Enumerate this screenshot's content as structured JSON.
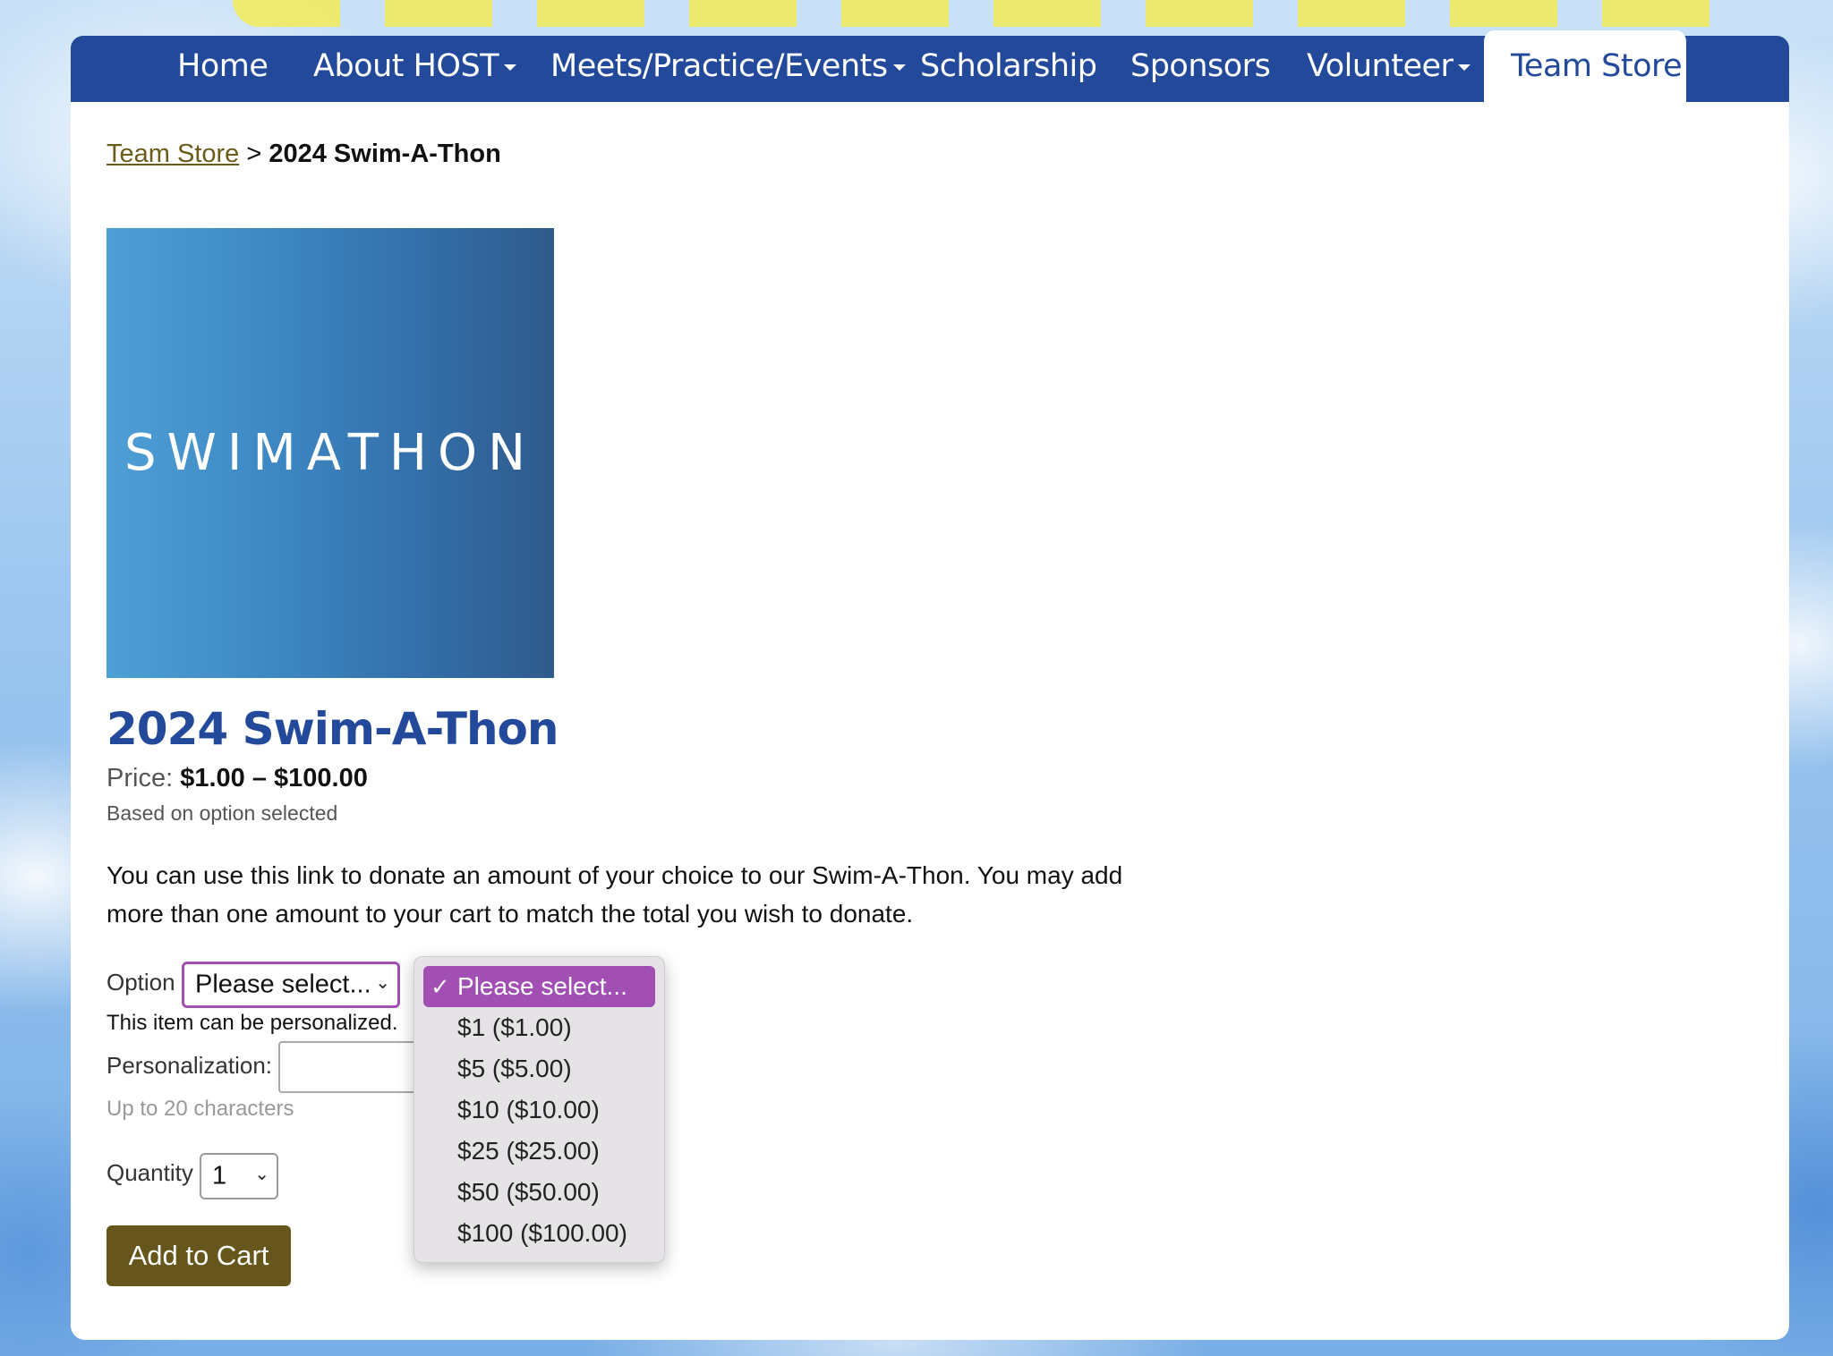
{
  "colors": {
    "nav_background": "#23499a",
    "title": "#23499a",
    "add_to_cart_bg": "#66561b",
    "selected_option": "#a24fb3"
  },
  "nav": {
    "items": [
      {
        "label": "Home",
        "has_caret": false
      },
      {
        "label": "About HOST",
        "has_caret": true
      },
      {
        "label": "Meets/Practice/Events",
        "has_caret": true
      },
      {
        "label": "Scholarship",
        "has_caret": false
      },
      {
        "label": "Sponsors",
        "has_caret": false
      },
      {
        "label": "Volunteer",
        "has_caret": true
      },
      {
        "label": "Team Store",
        "has_caret": false,
        "active": true
      }
    ]
  },
  "breadcrumb": {
    "parent": "Team Store",
    "separator": ">",
    "current": "2024 Swim-A-Thon"
  },
  "product": {
    "image_text": "SWIMATHON",
    "title": "2024 Swim-A-Thon",
    "price_label": "Price:",
    "price_range": "$1.00 – $100.00",
    "price_note": "Based on option selected",
    "description": "You can use this link to donate an amount of your choice to our Swim-A-Thon. You may add more than one amount to your cart to match the total you wish to donate."
  },
  "form": {
    "option_label": "Option",
    "option_value": "Please select...",
    "personalize_note": "This item can be personalized.",
    "personalization_label": "Personalization:",
    "personalization_value": "",
    "char_limit_note": "Up to 20 characters",
    "quantity_label": "Quantity",
    "quantity_value": "1",
    "add_to_cart_label": "Add to Cart"
  },
  "dropdown": {
    "options": [
      {
        "label": "Please select...",
        "selected": true
      },
      {
        "label": "$1 ($1.00)",
        "selected": false
      },
      {
        "label": "$5 ($5.00)",
        "selected": false
      },
      {
        "label": "$10 ($10.00)",
        "selected": false
      },
      {
        "label": "$25 ($25.00)",
        "selected": false
      },
      {
        "label": "$50 ($50.00)",
        "selected": false
      },
      {
        "label": "$100 ($100.00)",
        "selected": false
      }
    ]
  }
}
